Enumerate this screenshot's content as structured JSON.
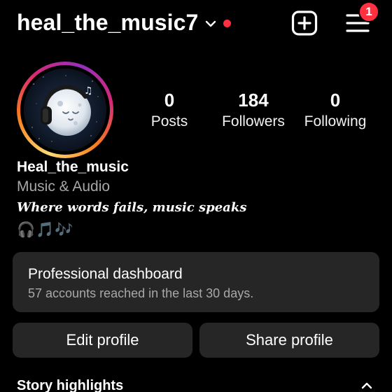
{
  "header": {
    "username": "heal_the_music7",
    "notification_count": "1",
    "icons": {
      "account_switch": "chevron-down-icon",
      "create": "plus-square-icon",
      "menu": "hamburger-menu-icon"
    },
    "colors": {
      "live_dot": "#ff3040",
      "badge": "#ff3040"
    }
  },
  "profile": {
    "avatar": "moon-headphones-avatar",
    "stats": [
      {
        "value": "0",
        "label": "Posts"
      },
      {
        "value": "184",
        "label": "Followers"
      },
      {
        "value": "0",
        "label": "Following"
      }
    ],
    "display_name": "Heal_the_music",
    "category": "Music & Audio",
    "bio": "Where words fails, music speaks",
    "bio_emojis": "🎧🎵🎶"
  },
  "dashboard": {
    "title": "Professional dashboard",
    "subtitle": "57 accounts reached in the last 30 days."
  },
  "actions": {
    "edit_label": "Edit profile",
    "share_label": "Share profile"
  },
  "highlights": {
    "title": "Story highlights",
    "toggle_icon": "chevron-up-icon"
  }
}
